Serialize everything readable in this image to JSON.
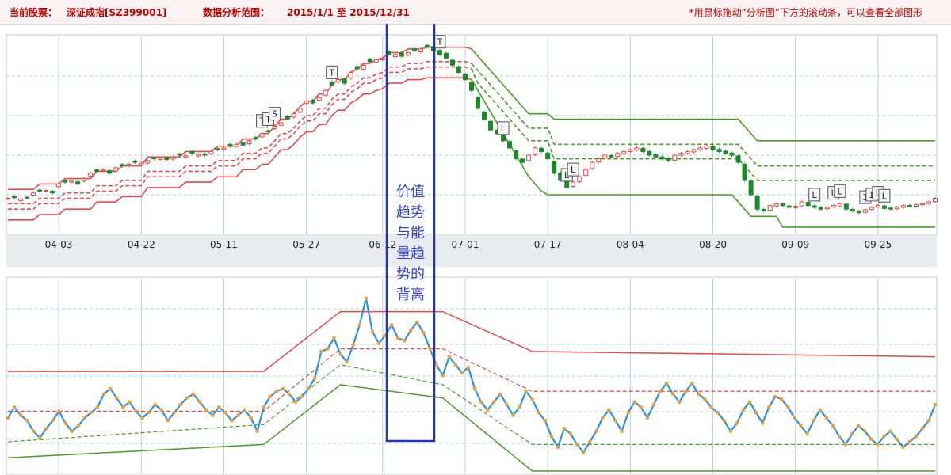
{
  "header": {
    "stock_label": "当前股票：",
    "stock_name": "深证成指[SZ399001]",
    "range_label": "数据分析范围：",
    "range_value": "2015/1/1 至 2015/12/31",
    "hint": "*用鼠标拖动“分析图”下方的滚动条，可以查看全部图形"
  },
  "annotation": {
    "lines": [
      "价值",
      "趋势",
      "与能",
      "量趋",
      "势的",
      "背离"
    ]
  },
  "colors": {
    "up": "#e84848",
    "down": "#1a8a2a",
    "band_red": "#e84848",
    "band_green": "#4a9a2a",
    "momentum": "#2f8fe0",
    "momentum_dot": "#f0a030",
    "grid": "#b0d4dc",
    "highlight_box": "#2233bb"
  },
  "chart_data": [
    {
      "type": "candlestick",
      "title": "",
      "x_ticks": [
        "04-03",
        "04-22",
        "05-11",
        "05-27",
        "06-12",
        "07-01",
        "07-17",
        "08-04",
        "08-20",
        "09-09",
        "09-25"
      ],
      "ohlc_close": [
        10500,
        10520,
        10480,
        10510,
        10650,
        10700,
        10720,
        10650,
        10900,
        10950,
        10980,
        10900,
        11050,
        11200,
        11250,
        11300,
        11200,
        11350,
        11400,
        11450,
        11500,
        11480,
        11550,
        11600,
        11620,
        11580,
        11650,
        11700,
        11680,
        11750,
        11720,
        11700,
        11800,
        11850,
        11900,
        11950,
        12000,
        11980,
        12100,
        12150,
        12300,
        12350,
        12500,
        12600,
        12700,
        12850,
        13000,
        13200,
        13150,
        13300,
        13500,
        13650,
        13800,
        13700,
        14000,
        14100,
        14200,
        14300,
        14350,
        14400,
        14500,
        14500,
        14450,
        14550,
        14600,
        14650,
        14700,
        14600,
        14500,
        14400,
        14200,
        14000,
        13800,
        13500,
        13000,
        12700,
        12400,
        12300,
        12100,
        11900,
        11600,
        11500,
        11700,
        11900,
        11800,
        11600,
        11200,
        11000,
        10800,
        10950,
        11100,
        11300,
        11500,
        11600,
        11700,
        11650,
        11750,
        11800,
        11850,
        11900,
        11800,
        11700,
        11650,
        11600,
        11550,
        11700,
        11750,
        11800,
        11850,
        11900,
        11950,
        11850,
        11800,
        11750,
        11700,
        11500,
        11000,
        10600,
        10200,
        10150,
        10300,
        10350,
        10300,
        10250,
        10280,
        10400,
        10300,
        10250,
        10200,
        10250,
        10300,
        10350,
        10200,
        10150,
        10100,
        10180,
        10250,
        10300,
        10220,
        10200,
        10250,
        10300,
        10280,
        10320,
        10350,
        10400,
        10500
      ],
      "open_delta": [
        -20,
        30,
        -40,
        20,
        -60,
        30,
        -20,
        50,
        -80,
        40,
        -30,
        60,
        -70,
        -80,
        40,
        -30,
        70,
        -90,
        40,
        -50,
        30,
        -40,
        -70,
        30,
        -40,
        50,
        -60,
        30,
        -40,
        50,
        -40,
        30,
        -60,
        30,
        -40,
        50,
        -50,
        60,
        -80,
        40,
        -90,
        30,
        -60,
        -70,
        80,
        -90,
        -110,
        -60,
        80,
        -70,
        -130,
        80,
        -70,
        120,
        -160,
        60,
        -110,
        70,
        -60,
        -50,
        80,
        -60,
        90,
        -70,
        60,
        -80,
        50,
        120,
        110,
        130,
        140,
        160,
        150,
        220,
        300,
        200,
        240,
        90,
        160,
        180,
        220,
        90,
        -150,
        -190,
        90,
        160,
        320,
        200,
        180,
        -120,
        -140,
        -160,
        -170,
        -90,
        -80,
        40,
        -90,
        -60,
        -50,
        -60,
        90,
        100,
        60,
        50,
        60,
        -140,
        -50,
        -50,
        -60,
        -50,
        -60,
        90,
        60,
        60,
        60,
        180,
        450,
        380,
        360,
        40,
        -130,
        -60,
        50,
        40,
        -40,
        -110,
        90,
        40,
        50,
        -40,
        -40,
        -60,
        140,
        40,
        40,
        -70,
        -60,
        -40,
        70,
        30,
        -40,
        -50,
        20,
        -40,
        -30,
        -40,
        -90
      ],
      "upper_band": [
        10750,
        10750,
        10750,
        10750,
        10750,
        10900,
        10900,
        10900,
        10900,
        11050,
        11050,
        11050,
        11050,
        11050,
        11250,
        11250,
        11250,
        11250,
        11400,
        11400,
        11400,
        11400,
        11650,
        11650,
        11650,
        11650,
        11650,
        11650,
        11800,
        11800,
        11800,
        11800,
        11800,
        11950,
        11950,
        11950,
        11950,
        12150,
        12150,
        12150,
        12300,
        12300,
        12500,
        12700,
        12700,
        12850,
        13050,
        13200,
        13200,
        13400,
        13400,
        13650,
        13800,
        13800,
        14000,
        14100,
        14250,
        14250,
        14350,
        14400,
        14550,
        14550,
        14550,
        14650,
        14650,
        14650,
        14700,
        14700,
        14700,
        14700,
        14700,
        14700,
        14700,
        14650,
        14450,
        14250,
        14050,
        13850,
        13650,
        13450,
        13250,
        13050,
        12850,
        12850,
        12850,
        12850,
        12700,
        12700,
        12700,
        12700,
        12700,
        12700,
        12700,
        12700,
        12700,
        12700,
        12700,
        12700,
        12700,
        12700,
        12700,
        12700,
        12700,
        12700,
        12700,
        12700,
        12700,
        12700,
        12700,
        12700,
        12700,
        12700,
        12700,
        12700,
        12700,
        12700,
        12500,
        12300,
        12100,
        12100,
        12100,
        12100,
        12100,
        12100,
        12100,
        12100,
        12100,
        12100,
        12100,
        12100,
        12100,
        12100,
        12100,
        12100,
        12100,
        12100,
        12100,
        12100,
        12100,
        12100,
        12100,
        12100,
        12100,
        12100,
        12100,
        12100,
        12100
      ],
      "upper_mid": [
        10350,
        10350,
        10350,
        10350,
        10350,
        10500,
        10500,
        10500,
        10500,
        10650,
        10650,
        10650,
        10650,
        10650,
        10850,
        10850,
        10850,
        10850,
        11000,
        11000,
        11000,
        11000,
        11250,
        11250,
        11250,
        11250,
        11250,
        11250,
        11400,
        11400,
        11400,
        11400,
        11400,
        11550,
        11550,
        11550,
        11550,
        11750,
        11750,
        11750,
        11900,
        11900,
        12100,
        12300,
        12300,
        12450,
        12650,
        12800,
        12800,
        13000,
        13000,
        13250,
        13400,
        13400,
        13600,
        13700,
        13850,
        13850,
        13950,
        14000,
        14150,
        14150,
        14150,
        14250,
        14250,
        14250,
        14300,
        14300,
        14300,
        14300,
        14300,
        14300,
        14300,
        14250,
        14050,
        13850,
        13650,
        13450,
        13250,
        13050,
        12850,
        12650,
        12450,
        12450,
        12450,
        12450,
        12000,
        12000,
        12000,
        12000,
        12000,
        12000,
        12000,
        12000,
        12000,
        12000,
        12000,
        12000,
        12000,
        12000,
        12000,
        12000,
        12000,
        12000,
        12000,
        12000,
        12000,
        12000,
        12000,
        12000,
        12000,
        12000,
        12000,
        12000,
        12000,
        12000,
        11800,
        11600,
        11400,
        11400,
        11400,
        11400,
        11400,
        11400,
        11400,
        11400,
        11400,
        11400,
        11400,
        11400,
        11400,
        11400,
        11400,
        11400,
        11400,
        11400,
        11400,
        11400,
        11400,
        11400,
        11400,
        11400,
        11400,
        11400,
        11400,
        11400,
        11400
      ],
      "lower_mid": [
        10200,
        10200,
        10200,
        10200,
        10200,
        10350,
        10350,
        10350,
        10350,
        10500,
        10500,
        10500,
        10500,
        10500,
        10700,
        10700,
        10700,
        10700,
        10850,
        10850,
        10850,
        10850,
        11100,
        11100,
        11100,
        11100,
        11100,
        11100,
        11250,
        11250,
        11250,
        11250,
        11250,
        11400,
        11400,
        11400,
        11400,
        11600,
        11600,
        11600,
        11750,
        11750,
        11950,
        12150,
        12150,
        12300,
        12500,
        12650,
        12650,
        12850,
        12850,
        13100,
        13250,
        13250,
        13450,
        13550,
        13700,
        13700,
        13800,
        13850,
        14000,
        14000,
        14000,
        14100,
        14100,
        14100,
        14150,
        14150,
        14150,
        14150,
        14150,
        14150,
        14150,
        14100,
        13700,
        13500,
        13300,
        13100,
        12900,
        12700,
        12500,
        12300,
        12100,
        12100,
        12100,
        12100,
        11600,
        11600,
        11600,
        11600,
        11600,
        11600,
        11600,
        11600,
        11600,
        11600,
        11600,
        11600,
        11600,
        11600,
        11600,
        11600,
        11600,
        11600,
        11600,
        11600,
        11600,
        11600,
        11600,
        11600,
        11600,
        11600,
        11600,
        11600,
        11600,
        11600,
        11400,
        11200,
        11000,
        11000,
        11000,
        11000,
        11000,
        11000,
        11000,
        11000,
        11000,
        11000,
        11000,
        11000,
        11000,
        11000,
        11000,
        11000,
        11000,
        11000,
        11000,
        11000,
        11000,
        11000,
        11000,
        11000,
        11000,
        11000,
        11000,
        11000,
        11000
      ],
      "lower_band": [
        9900,
        9900,
        9900,
        9900,
        9900,
        10050,
        10050,
        10050,
        10050,
        10200,
        10200,
        10200,
        10200,
        10200,
        10400,
        10400,
        10400,
        10400,
        10550,
        10550,
        10550,
        10550,
        10800,
        10800,
        10800,
        10800,
        10800,
        10800,
        10950,
        10950,
        10950,
        10950,
        10950,
        11100,
        11100,
        11100,
        11100,
        11300,
        11300,
        11300,
        11450,
        11450,
        11650,
        11850,
        11850,
        12000,
        12200,
        12350,
        12350,
        12550,
        12550,
        12800,
        12950,
        12950,
        13150,
        13250,
        13400,
        13400,
        13500,
        13550,
        13700,
        13700,
        13700,
        13800,
        13800,
        13800,
        13850,
        13850,
        13850,
        13850,
        13850,
        13850,
        13850,
        13800,
        13500,
        13200,
        12900,
        12600,
        12300,
        12000,
        11700,
        11400,
        11100,
        10900,
        10700,
        10600,
        10600,
        10600,
        10600,
        10600,
        10600,
        10600,
        10600,
        10600,
        10600,
        10600,
        10600,
        10600,
        10600,
        10600,
        10600,
        10600,
        10600,
        10600,
        10600,
        10600,
        10600,
        10600,
        10600,
        10600,
        10600,
        10600,
        10600,
        10600,
        10600,
        10400,
        10200,
        10000,
        10000,
        10000,
        10000,
        10000,
        9700,
        9700,
        9700,
        9700,
        9700,
        9700,
        9700,
        9700,
        9700,
        9700,
        9700,
        9700,
        9700,
        9700,
        9700,
        9700,
        9700,
        9700,
        9700,
        9700,
        9700,
        9700,
        9700,
        9700,
        9700
      ],
      "markers": [
        {
          "i": 40,
          "label": "T"
        },
        {
          "i": 41,
          "label": "T"
        },
        {
          "i": 42,
          "label": "S"
        },
        {
          "i": 51,
          "label": "T"
        },
        {
          "i": 68,
          "label": "T"
        },
        {
          "i": 78,
          "label": "L"
        },
        {
          "i": 88,
          "label": "L"
        },
        {
          "i": 89,
          "label": "L"
        },
        {
          "i": 127,
          "label": "L"
        },
        {
          "i": 130,
          "label": "L"
        },
        {
          "i": 131,
          "label": "L"
        },
        {
          "i": 135,
          "label": "I"
        },
        {
          "i": 136,
          "label": "I"
        },
        {
          "i": 137,
          "label": "L"
        },
        {
          "i": 138,
          "label": "L"
        }
      ]
    },
    {
      "type": "line",
      "title": "",
      "values": [
        40,
        48,
        42,
        38,
        30,
        25,
        32,
        38,
        45,
        36,
        30,
        34,
        40,
        44,
        48,
        58,
        62,
        55,
        48,
        52,
        45,
        40,
        44,
        50,
        46,
        38,
        44,
        50,
        55,
        58,
        52,
        46,
        42,
        48,
        44,
        38,
        42,
        46,
        40,
        30,
        48,
        56,
        60,
        62,
        58,
        52,
        56,
        62,
        70,
        90,
        92,
        100,
        88,
        82,
        95,
        110,
        130,
        105,
        96,
        102,
        110,
        100,
        98,
        106,
        112,
        104,
        92,
        80,
        72,
        86,
        80,
        74,
        78,
        62,
        52,
        46,
        52,
        58,
        50,
        42,
        48,
        60,
        54,
        44,
        38,
        26,
        18,
        32,
        28,
        20,
        14,
        22,
        30,
        40,
        46,
        38,
        30,
        44,
        52,
        48,
        40,
        50,
        60,
        66,
        58,
        52,
        60,
        66,
        58,
        54,
        48,
        44,
        38,
        30,
        36,
        46,
        52,
        44,
        36,
        48,
        56,
        54,
        48,
        40,
        34,
        28,
        38,
        46,
        40,
        34,
        26,
        20,
        28,
        34,
        30,
        24,
        20,
        26,
        30,
        24,
        18,
        22,
        26,
        32,
        38,
        50
      ]
    }
  ]
}
